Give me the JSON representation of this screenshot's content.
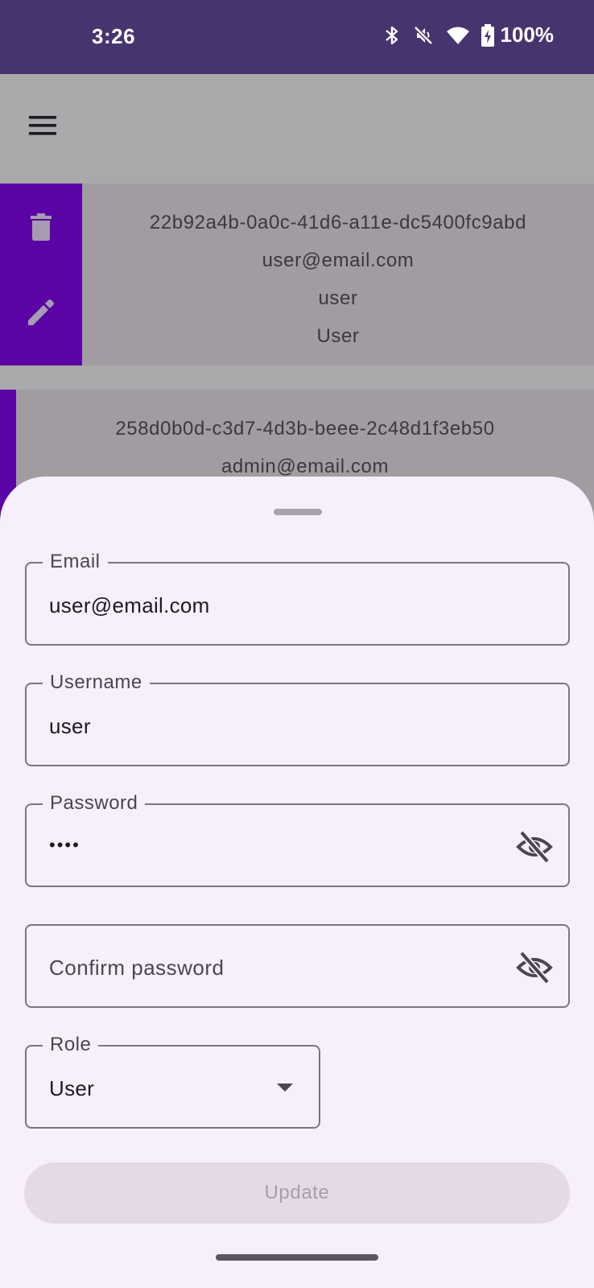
{
  "status_bar": {
    "time": "3:26",
    "battery": "100%",
    "icons": [
      "bluetooth-icon",
      "mute-icon",
      "wifi-icon",
      "battery-charging-icon"
    ]
  },
  "app_bar": {
    "menu_icon": "menu-icon"
  },
  "users": [
    {
      "id": "22b92a4b-0a0c-41d6-a11e-dc5400fc9abd",
      "email": "user@email.com",
      "username": "user",
      "role": "User"
    },
    {
      "id": "258d0b0d-c3d7-4d3b-beee-2c48d1f3eb50",
      "email": "admin@email.com"
    }
  ],
  "form": {
    "email_label": "Email",
    "email_value": "user@email.com",
    "username_label": "Username",
    "username_value": "user",
    "password_label": "Password",
    "password_value": "••••",
    "confirm_placeholder": "Confirm password",
    "role_label": "Role",
    "role_value": "User",
    "update_label": "Update"
  },
  "colors": {
    "status_bar": "#46346f",
    "accent": "#5a04a6",
    "sheet": "#f8effc"
  }
}
